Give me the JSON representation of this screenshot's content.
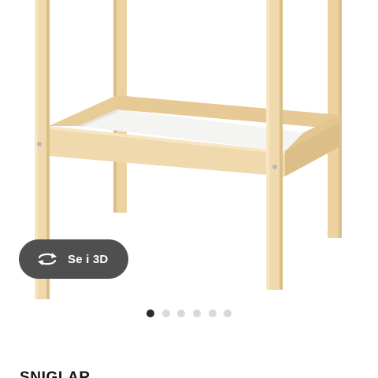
{
  "product_image": {
    "alt_icon": "changing-table-image"
  },
  "view_3d": {
    "label": "Se i 3D",
    "icon": "rotate-3d-icon"
  },
  "gallery": {
    "total_images": 6,
    "active_index": 0
  },
  "product": {
    "name": "SNIGLAR"
  },
  "colors": {
    "button_bg": "#4f4f4f",
    "dot_active": "#2b2b2b",
    "dot_inactive": "#d9d9d9",
    "wood": "#f0d9ac",
    "wood_shadow": "#dcbf88",
    "tray_surface": "#f4f4f2"
  }
}
